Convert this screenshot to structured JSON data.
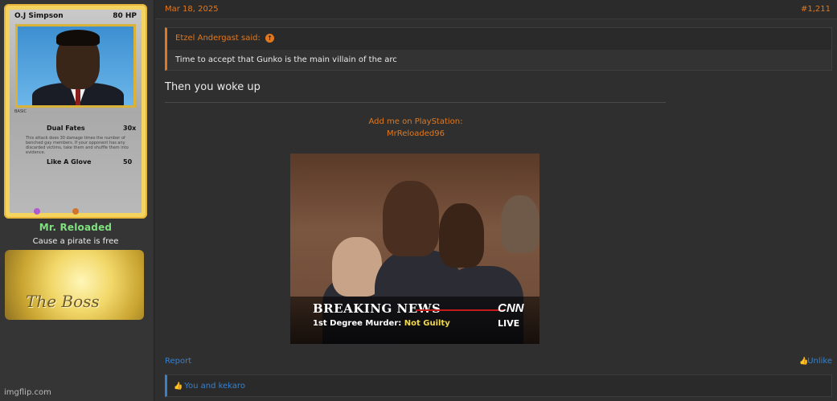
{
  "user": {
    "card": {
      "name": "O.J Simpson",
      "hp": "80 HP",
      "basic": "BASIC",
      "attack1_name": "Dual Fates",
      "attack1_damage": "30x",
      "attack1_desc": "This attack does 30 damage times the number of benched gay members. If your opponent has any discarded victims, take them and shuffle them into evidence.",
      "attack2_name": "Like A Glove",
      "attack2_damage": "50"
    },
    "username": "Mr. Reloaded",
    "title": "Cause a pirate is free",
    "banner_text": "The Boss",
    "watermark": "imgflip.com"
  },
  "post": {
    "date": "Mar 18, 2025",
    "number": "#1,211",
    "quote": {
      "author": "Etzel Andergast said:",
      "text": "Time to accept that Gunko is the main villain of the arc"
    },
    "body": "Then you woke up",
    "signature": {
      "line1": "Add me on PlayStation:",
      "line2": "MrReloaded96",
      "gif": {
        "headline": "BREAKING NEWS",
        "network": "CNN",
        "subline_prefix": "1st Degree Murder:",
        "subline_verdict": "Not Guilty",
        "live": "LIVE"
      }
    },
    "footer": {
      "report": "Report",
      "unlike": "Unlike"
    },
    "likes": "You and kekaro"
  },
  "colors": {
    "accent_orange": "#e0781f",
    "link_blue": "#3a80c9",
    "username_green": "#7fe07f"
  }
}
